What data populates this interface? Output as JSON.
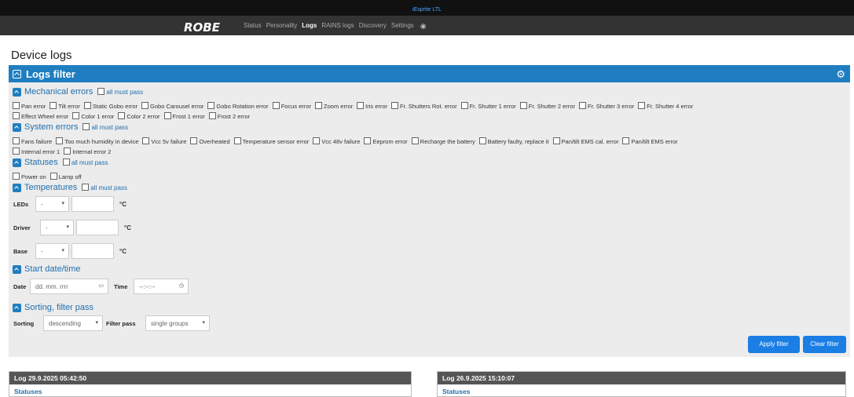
{
  "brand": "iEsprite LTL",
  "logo": "ROBE",
  "nav": [
    "Status",
    "Personality",
    "Logs",
    "RAINS logs",
    "Discovery",
    "Settings"
  ],
  "nav_active": "Logs",
  "page_title": "Device logs",
  "filter_panel": {
    "title": "Logs filter",
    "all_must_pass": "all must pass",
    "mechanical": {
      "title": "Mechanical errors",
      "row1": [
        "Pan error",
        "Tilt error",
        "Static Gobo error",
        "Gobo Carousel error",
        "Gobo Rotation error",
        "Focus error",
        "Zoom error",
        "Iris error",
        "Fr. Shutters Rot. error",
        "Fr. Shutter 1 error",
        "Fr. Shutter 2 error",
        "Fr. Shutter 3 error",
        "Fr. Shutter 4 error"
      ],
      "row2": [
        "Effect Wheel error",
        "Color 1 error",
        "Color 2 error",
        "Frost 1 error",
        "Frost 2 error"
      ]
    },
    "system": {
      "title": "System errors",
      "row1": [
        "Fans failure",
        "Too much humidity in device",
        "Vcc 5v failure",
        "Overheated",
        "Temperature sensor error",
        "Vcc 48v failure",
        "Eeprom error",
        "Recharge the battery",
        "Battery faulty, replace it",
        "Pan/tilt EMS cal. error",
        "Pan/tilt EMS error"
      ],
      "row2": [
        "Internal error 1",
        "Internal error 2"
      ]
    },
    "statuses": {
      "title": "Statuses",
      "row1": [
        "Power on",
        "Lamp off"
      ]
    },
    "temperatures": {
      "title": "Temperatures",
      "leds_label": "LEDs",
      "driver_label": "Driver",
      "base_label": "Base",
      "select_value": "-",
      "unit": "°C"
    },
    "start": {
      "title": "Start date/time",
      "date_label": "Date",
      "date_placeholder": "dd. mm. rrrr",
      "time_label": "Time",
      "time_placeholder": "--:--:--"
    },
    "sorting": {
      "title": "Sorting, filter pass",
      "sorting_label": "Sorting",
      "sorting_value": "descending",
      "filter_label": "Filter pass",
      "filter_value": "single groups"
    },
    "apply_label": "Apply filter",
    "clear_label": "Clear filter"
  },
  "logs": [
    {
      "header": "Log 29.9.2025 05:42:50",
      "section": "Statuses"
    },
    {
      "header": "Log 26.9.2025 15:10:07",
      "section": "Statuses"
    }
  ],
  "colors": {
    "accent": "#1f7ec0",
    "button": "#1a7ee5",
    "navbar": "#333333"
  }
}
